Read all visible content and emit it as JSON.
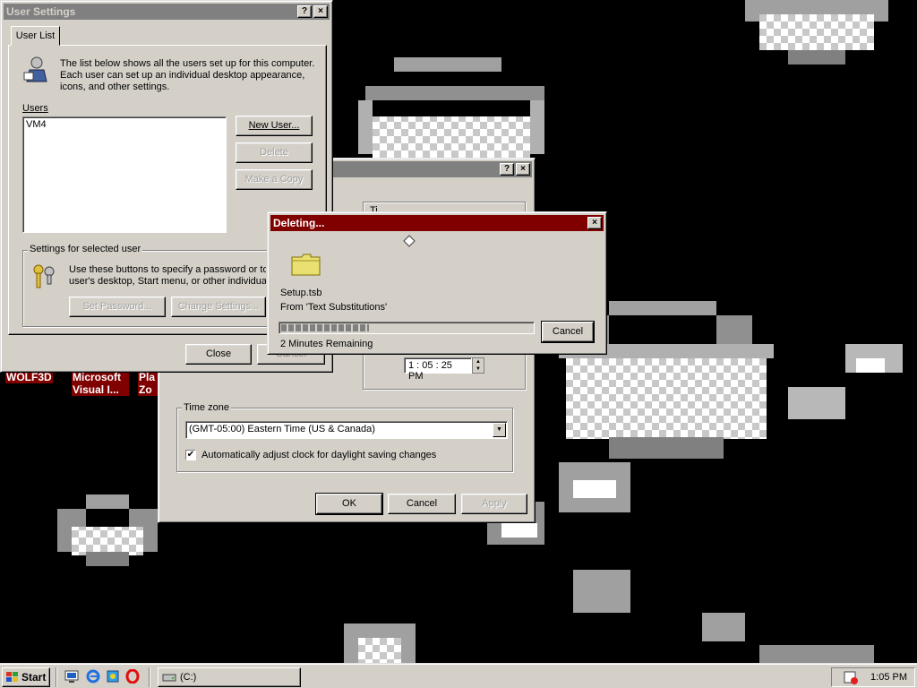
{
  "desktop": {
    "icons": [
      {
        "label_line1": "WOLF3D",
        "label_line2": ""
      },
      {
        "label_line1": "Microsoft",
        "label_line2": "Visual I..."
      },
      {
        "label_line1": "Pla",
        "label_line2": "Zo"
      }
    ]
  },
  "user_settings": {
    "title": "User Settings",
    "help_btn": "?",
    "close_btn": "×",
    "tab_label": "User List",
    "intro_text_1": "The list below shows all the users set up for this computer.",
    "intro_text_2": "Each user can set up an individual desktop appearance,",
    "intro_text_3": "icons, and other settings.",
    "users_label": "Users",
    "users": [
      "VM4"
    ],
    "new_user_btn": "New User...",
    "delete_btn": "Delete",
    "make_copy_btn": "Make a Copy",
    "group_label": "Settings for selected user",
    "settings_text_1": "Use these buttons to specify a password or to s",
    "settings_text_2": "user's desktop, Start menu, or other individual fi",
    "set_password_btn": "Set Password...",
    "change_settings_btn": "Change Settings...",
    "close_label": "Close",
    "cancel_label": "Cancel"
  },
  "datetime": {
    "help_btn": "?",
    "close_btn": "×",
    "time_value": "1 : 05 : 25 PM",
    "time_zone_label": "Time zone",
    "time_zone_value": "(GMT-05:00) Eastern Time (US & Canada)",
    "dst_checkbox_label": "Automatically adjust clock for daylight saving changes",
    "dst_checked": true,
    "ok_btn": "OK",
    "cancel_btn": "Cancel",
    "apply_btn": "Apply",
    "partial_tab": "Ti"
  },
  "deleting": {
    "title": "Deleting...",
    "close_btn": "×",
    "file_name": "Setup.tsb",
    "from_text": "From 'Text Substitutions'",
    "progress_fraction": 0.35,
    "remaining_text": "2 Minutes Remaining",
    "cancel_btn": "Cancel"
  },
  "taskbar": {
    "start_label": "Start",
    "task_label": "(C:)",
    "clock": "1:05 PM",
    "quicklaunch": [
      "desktop-icon",
      "ie-icon",
      "channels-icon",
      "opera-icon"
    ]
  },
  "colors": {
    "desktop_bg": "#000000",
    "face": "#d4d0c8",
    "active_title": "#800000",
    "inactive_title": "#808080"
  }
}
